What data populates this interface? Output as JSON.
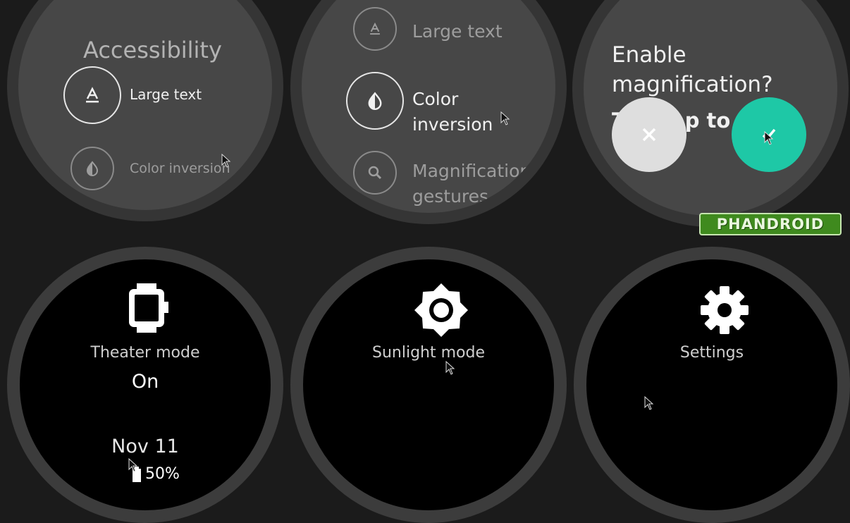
{
  "watch1": {
    "title": "Accessibility",
    "items": [
      {
        "label": "Large text",
        "icon": "large-text-icon"
      },
      {
        "label": "Color inversion",
        "icon": "color-inversion-icon"
      }
    ]
  },
  "watch2": {
    "items": [
      {
        "label": "Large text",
        "icon": "large-text-icon"
      },
      {
        "label_line1": "Color",
        "label_line2": "inversion",
        "icon": "color-inversion-icon"
      },
      {
        "label_line1": "Magnification",
        "label_line2": "gestures",
        "icon": "magnification-icon"
      }
    ]
  },
  "watch3": {
    "question_line1": "Enable",
    "question_line2": "magnification?",
    "partial_line": "T     tap to z",
    "cancel_color": "#dedede",
    "confirm_color": "#1ec8a6"
  },
  "watch4": {
    "label": "Theater mode",
    "status": "On",
    "date": "Nov 11",
    "battery": "50%"
  },
  "watch5": {
    "label": "Sunlight mode"
  },
  "watch6": {
    "label": "Settings"
  },
  "watermark": "PHANDROID"
}
